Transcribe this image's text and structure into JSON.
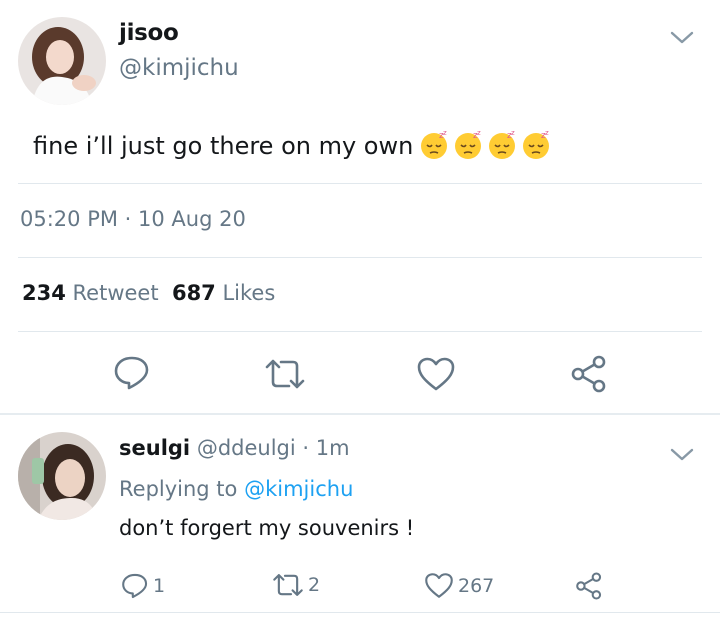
{
  "tweet": {
    "author_name": "jisoo",
    "author_handle": "@kimjichu",
    "text": "fine i’ll just go there on my own",
    "emojis": [
      "sleepy-face",
      "sleepy-face",
      "sleepy-face",
      "sleepy-face"
    ],
    "timestamp": "05:20 PM · 10 Aug 20",
    "retweet_count": "234",
    "retweet_label": "Retweet",
    "like_count": "687",
    "like_label": "Likes",
    "actions": [
      "reply-icon",
      "retweet-icon",
      "heart-icon",
      "share-icon"
    ]
  },
  "reply": {
    "author_name": "seulgi",
    "author_handle": "@ddeulgi",
    "time": "· 1m",
    "replying_label": "Replying to",
    "replying_to": "@kimjichu",
    "text": "don’t forgert my souvenirs !",
    "reply_count": "1",
    "retweet_count": "2",
    "like_count": "267"
  },
  "colors": {
    "text": "#14171a",
    "secondary": "#657786",
    "link": "#1da1f2",
    "divider": "#e1e8ed"
  }
}
